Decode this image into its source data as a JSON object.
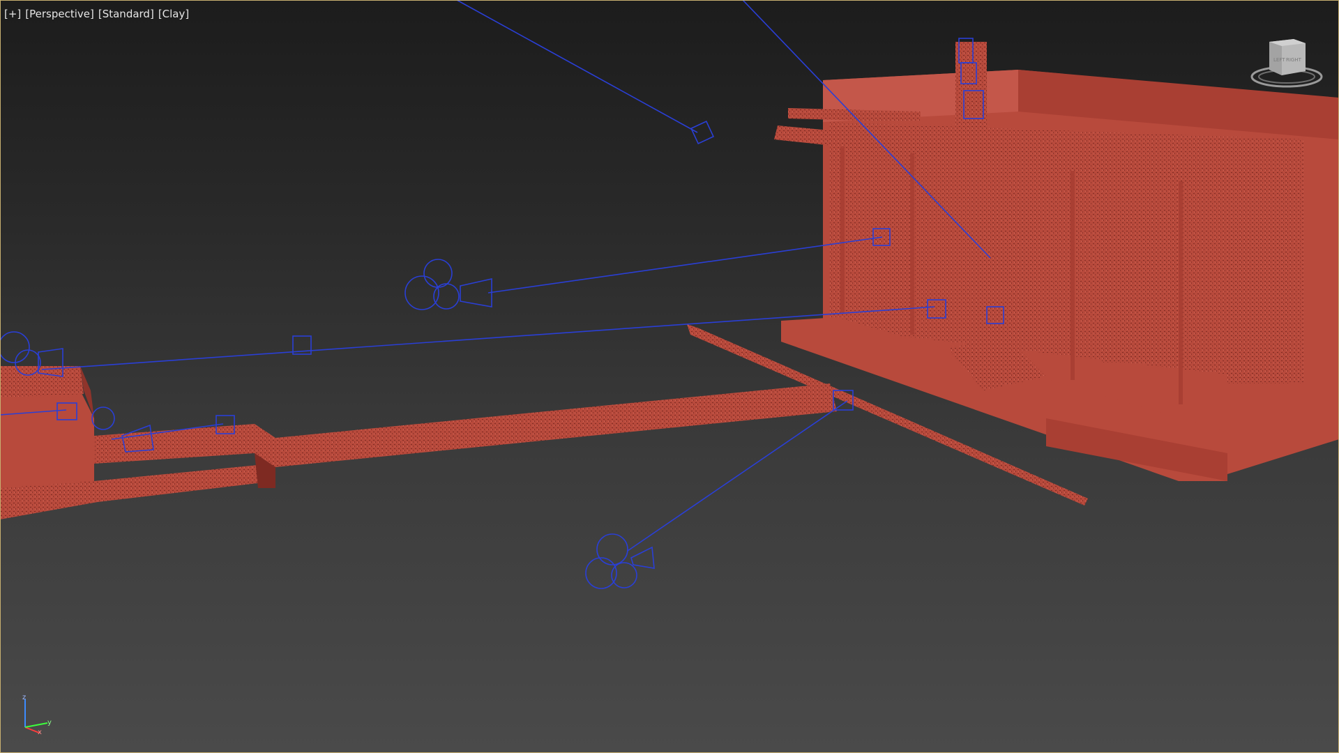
{
  "viewport": {
    "menu_label": "[+]",
    "view_label": "[Perspective]",
    "shading_label": "[Standard]",
    "style_label": "[Clay]"
  },
  "viewcube": {
    "face_left": "LEFT",
    "face_right": "RIGHT"
  },
  "axis": {
    "z": "z",
    "x": "x",
    "y": "y"
  },
  "colors": {
    "background_top": "#1c1c1c",
    "background_bottom": "#4a4a4a",
    "clay": "#b84a3c",
    "clay_dark": "#7e2a22",
    "wire": "#2a3fd6",
    "frame": "#c8b070"
  },
  "icons": [
    "viewcube-icon",
    "axis-tripod-icon",
    "camera-icon",
    "light-icon",
    "target-icon"
  ]
}
